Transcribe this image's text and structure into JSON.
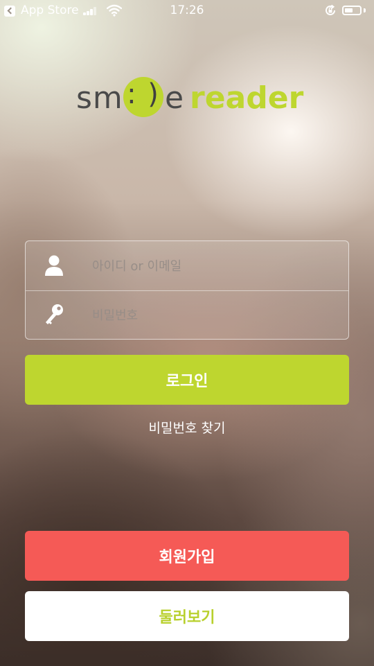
{
  "status_bar": {
    "back_app": "App Store",
    "time": "17:26",
    "battery_level": 0.55
  },
  "logo": {
    "sm": "sm",
    "face": ": )",
    "e": "e",
    "reader": "reader"
  },
  "login_form": {
    "id_placeholder": "아이디 or 이메일",
    "password_placeholder": "비밀번호",
    "login_label": "로그인",
    "find_password_label": "비밀번호 찾기"
  },
  "actions": {
    "signup_label": "회원가입",
    "browse_label": "둘러보기"
  },
  "colors": {
    "brand_green": "#bed62f",
    "signup_red": "#f55a56",
    "white": "#ffffff"
  }
}
